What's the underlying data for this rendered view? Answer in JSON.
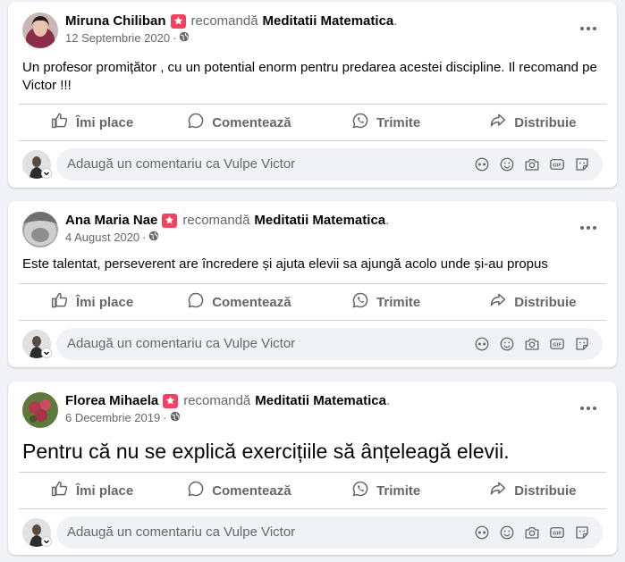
{
  "recommends_text": "recomandă",
  "page_name": "Meditatii Matematica",
  "page_name_suffix": ".",
  "date_separator": "·",
  "actions": {
    "like": "Îmi place",
    "comment": "Comentează",
    "send": "Trimite",
    "share": "Distribuie"
  },
  "comment_placeholder": "Adaugă un comentariu ca Vulpe Victor",
  "colors": {
    "badge": "#f3425f",
    "muted": "#65676b",
    "background": "#f0f2f5"
  },
  "posts": [
    {
      "author": "Miruna Chiliban",
      "date": "12 Septembrie 2020",
      "text": "Un profesor promițător , cu un potential enorm pentru predarea acestei discipline. Il recomand pe Victor !!!"
    },
    {
      "author": "Ana Maria Nae",
      "date": "4 August 2020",
      "text": "Este talentat, perseverent are încredere și ajuta elevii sa ajungă acolo unde și-au propus"
    },
    {
      "author": "Florea Mihaela",
      "date": "6 Decembrie 2019",
      "text": "Pentru că nu se explică exercițiile să ânțeleagă elevii."
    }
  ]
}
